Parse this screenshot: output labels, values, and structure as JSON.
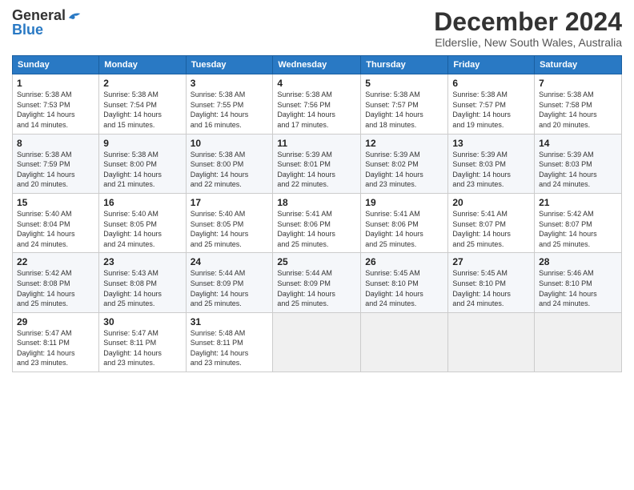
{
  "logo": {
    "general": "General",
    "blue": "Blue"
  },
  "header": {
    "month": "December 2024",
    "location": "Elderslie, New South Wales, Australia"
  },
  "days_of_week": [
    "Sunday",
    "Monday",
    "Tuesday",
    "Wednesday",
    "Thursday",
    "Friday",
    "Saturday"
  ],
  "weeks": [
    [
      {
        "day": "1",
        "info": "Sunrise: 5:38 AM\nSunset: 7:53 PM\nDaylight: 14 hours\nand 14 minutes."
      },
      {
        "day": "2",
        "info": "Sunrise: 5:38 AM\nSunset: 7:54 PM\nDaylight: 14 hours\nand 15 minutes."
      },
      {
        "day": "3",
        "info": "Sunrise: 5:38 AM\nSunset: 7:55 PM\nDaylight: 14 hours\nand 16 minutes."
      },
      {
        "day": "4",
        "info": "Sunrise: 5:38 AM\nSunset: 7:56 PM\nDaylight: 14 hours\nand 17 minutes."
      },
      {
        "day": "5",
        "info": "Sunrise: 5:38 AM\nSunset: 7:57 PM\nDaylight: 14 hours\nand 18 minutes."
      },
      {
        "day": "6",
        "info": "Sunrise: 5:38 AM\nSunset: 7:57 PM\nDaylight: 14 hours\nand 19 minutes."
      },
      {
        "day": "7",
        "info": "Sunrise: 5:38 AM\nSunset: 7:58 PM\nDaylight: 14 hours\nand 20 minutes."
      }
    ],
    [
      {
        "day": "8",
        "info": "Sunrise: 5:38 AM\nSunset: 7:59 PM\nDaylight: 14 hours\nand 20 minutes."
      },
      {
        "day": "9",
        "info": "Sunrise: 5:38 AM\nSunset: 8:00 PM\nDaylight: 14 hours\nand 21 minutes."
      },
      {
        "day": "10",
        "info": "Sunrise: 5:38 AM\nSunset: 8:00 PM\nDaylight: 14 hours\nand 22 minutes."
      },
      {
        "day": "11",
        "info": "Sunrise: 5:39 AM\nSunset: 8:01 PM\nDaylight: 14 hours\nand 22 minutes."
      },
      {
        "day": "12",
        "info": "Sunrise: 5:39 AM\nSunset: 8:02 PM\nDaylight: 14 hours\nand 23 minutes."
      },
      {
        "day": "13",
        "info": "Sunrise: 5:39 AM\nSunset: 8:03 PM\nDaylight: 14 hours\nand 23 minutes."
      },
      {
        "day": "14",
        "info": "Sunrise: 5:39 AM\nSunset: 8:03 PM\nDaylight: 14 hours\nand 24 minutes."
      }
    ],
    [
      {
        "day": "15",
        "info": "Sunrise: 5:40 AM\nSunset: 8:04 PM\nDaylight: 14 hours\nand 24 minutes."
      },
      {
        "day": "16",
        "info": "Sunrise: 5:40 AM\nSunset: 8:05 PM\nDaylight: 14 hours\nand 24 minutes."
      },
      {
        "day": "17",
        "info": "Sunrise: 5:40 AM\nSunset: 8:05 PM\nDaylight: 14 hours\nand 25 minutes."
      },
      {
        "day": "18",
        "info": "Sunrise: 5:41 AM\nSunset: 8:06 PM\nDaylight: 14 hours\nand 25 minutes."
      },
      {
        "day": "19",
        "info": "Sunrise: 5:41 AM\nSunset: 8:06 PM\nDaylight: 14 hours\nand 25 minutes."
      },
      {
        "day": "20",
        "info": "Sunrise: 5:41 AM\nSunset: 8:07 PM\nDaylight: 14 hours\nand 25 minutes."
      },
      {
        "day": "21",
        "info": "Sunrise: 5:42 AM\nSunset: 8:07 PM\nDaylight: 14 hours\nand 25 minutes."
      }
    ],
    [
      {
        "day": "22",
        "info": "Sunrise: 5:42 AM\nSunset: 8:08 PM\nDaylight: 14 hours\nand 25 minutes."
      },
      {
        "day": "23",
        "info": "Sunrise: 5:43 AM\nSunset: 8:08 PM\nDaylight: 14 hours\nand 25 minutes."
      },
      {
        "day": "24",
        "info": "Sunrise: 5:44 AM\nSunset: 8:09 PM\nDaylight: 14 hours\nand 25 minutes."
      },
      {
        "day": "25",
        "info": "Sunrise: 5:44 AM\nSunset: 8:09 PM\nDaylight: 14 hours\nand 25 minutes."
      },
      {
        "day": "26",
        "info": "Sunrise: 5:45 AM\nSunset: 8:10 PM\nDaylight: 14 hours\nand 24 minutes."
      },
      {
        "day": "27",
        "info": "Sunrise: 5:45 AM\nSunset: 8:10 PM\nDaylight: 14 hours\nand 24 minutes."
      },
      {
        "day": "28",
        "info": "Sunrise: 5:46 AM\nSunset: 8:10 PM\nDaylight: 14 hours\nand 24 minutes."
      }
    ],
    [
      {
        "day": "29",
        "info": "Sunrise: 5:47 AM\nSunset: 8:11 PM\nDaylight: 14 hours\nand 23 minutes."
      },
      {
        "day": "30",
        "info": "Sunrise: 5:47 AM\nSunset: 8:11 PM\nDaylight: 14 hours\nand 23 minutes."
      },
      {
        "day": "31",
        "info": "Sunrise: 5:48 AM\nSunset: 8:11 PM\nDaylight: 14 hours\nand 23 minutes."
      },
      null,
      null,
      null,
      null
    ]
  ]
}
